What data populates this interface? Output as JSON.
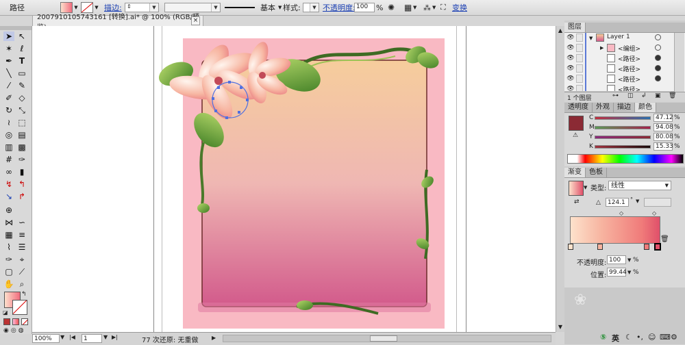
{
  "control_bar": {
    "label": "路径",
    "stroke_link": "描边:",
    "stroke_profile": "基本",
    "style_label": "样式:",
    "opacity_link": "不透明度:",
    "opacity_value": "100",
    "opacity_unit": "%",
    "transform_link": "变换"
  },
  "document": {
    "tab_title": "2007910105743161 [转换].ai* @ 100% (RGB/预览)",
    "close_glyph": "×"
  },
  "status_bar": {
    "zoom": "100%",
    "artboard": "1",
    "undo_text": "77 次还原: 无重做"
  },
  "layers_panel": {
    "title": "图层",
    "rows": [
      {
        "name": "Layer 1"
      },
      {
        "name": "<编组>"
      },
      {
        "name": "<路径>"
      },
      {
        "name": "<路径>"
      },
      {
        "name": "<路径>"
      },
      {
        "name": "<路径>"
      }
    ],
    "footer_count": "1 个图层"
  },
  "color_panel": {
    "tabs": [
      "透明度",
      "外观",
      "描边",
      "颜色"
    ],
    "channels": [
      {
        "label": "C",
        "value": "47.12",
        "unit": "%"
      },
      {
        "label": "M",
        "value": "94.08",
        "unit": "%"
      },
      {
        "label": "Y",
        "value": "80.08",
        "unit": "%"
      },
      {
        "label": "K",
        "value": "15.33",
        "unit": "%"
      }
    ],
    "fill_color": "#8b2a34"
  },
  "gradient_panel": {
    "tabs": [
      "渐变",
      "色板"
    ],
    "type_label": "类型:",
    "type_value": "线性",
    "angle_value": "124.1",
    "angle_unit": "°",
    "opacity_label": "不透明度:",
    "opacity_value": "100",
    "opacity_unit": "%",
    "position_label": "位置:",
    "position_value": "99.44",
    "position_unit": "%",
    "colors": [
      "#fde2cc",
      "#f7a9a5",
      "#e0506a"
    ]
  },
  "taskbar": {
    "ime_label": "英"
  },
  "artwork": {
    "frame_bg": "#f9b9c3",
    "panel_top": "#f6cd9c",
    "panel_bottom": "#d25a8b"
  }
}
